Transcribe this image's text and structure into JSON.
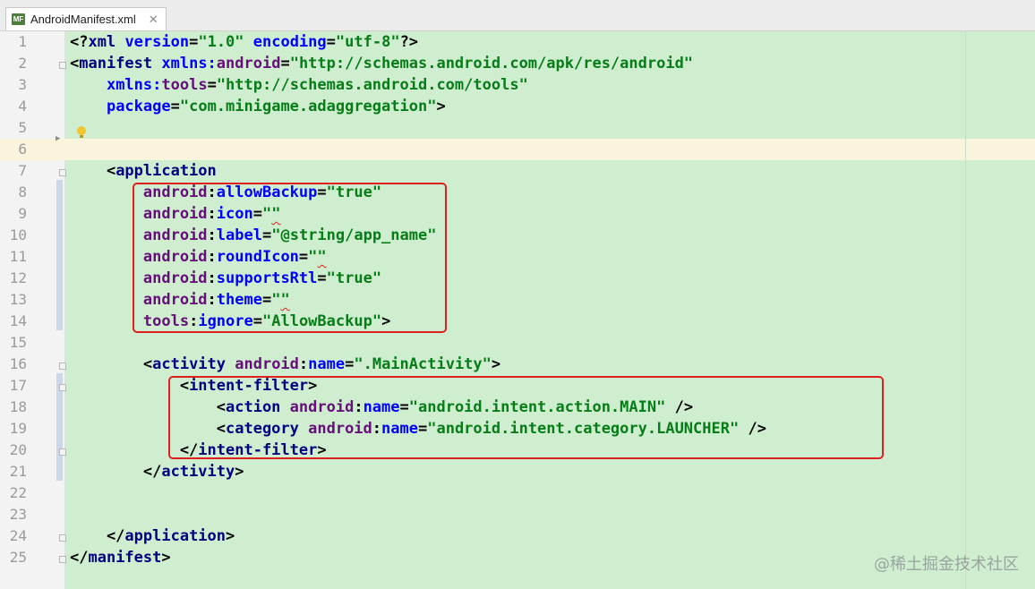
{
  "tab": {
    "file_name": "AndroidManifest.xml",
    "icon_label": "MF",
    "close_glyph": "✕"
  },
  "code": {
    "line_numbers": [
      "1",
      "2",
      "3",
      "4",
      "5",
      "6",
      "7",
      "8",
      "9",
      "10",
      "11",
      "12",
      "13",
      "14",
      "15",
      "16",
      "17",
      "18",
      "19",
      "20",
      "21",
      "22",
      "23",
      "24",
      "25"
    ],
    "current_line": 6,
    "lines": [
      {
        "n": 1,
        "parts": [
          [
            "p",
            "<?"
          ],
          [
            "tag",
            "xml "
          ],
          [
            "attr",
            "version"
          ],
          [
            "p",
            "="
          ],
          [
            "val",
            "\"1.0\" "
          ],
          [
            "attr",
            "encoding"
          ],
          [
            "p",
            "="
          ],
          [
            "val",
            "\"utf-8\""
          ],
          [
            "p",
            "?>"
          ]
        ]
      },
      {
        "n": 2,
        "parts": [
          [
            "p",
            "<"
          ],
          [
            "tag",
            "manifest "
          ],
          [
            "attr",
            "xmlns:"
          ],
          [
            "ns",
            "android"
          ],
          [
            "p",
            "="
          ],
          [
            "val",
            "\"http://schemas.android.com/apk/res/android\""
          ]
        ]
      },
      {
        "n": 3,
        "parts": [
          [
            "p",
            "    "
          ],
          [
            "attr",
            "xmlns:"
          ],
          [
            "ns",
            "tools"
          ],
          [
            "p",
            "="
          ],
          [
            "val",
            "\"http://schemas.android.com/tools\""
          ]
        ]
      },
      {
        "n": 4,
        "parts": [
          [
            "p",
            "    "
          ],
          [
            "attr",
            "package"
          ],
          [
            "p",
            "="
          ],
          [
            "val",
            "\"com.minigame.adaggregation\""
          ],
          [
            "p",
            ">"
          ]
        ]
      },
      {
        "n": 5,
        "parts": []
      },
      {
        "n": 6,
        "parts": []
      },
      {
        "n": 7,
        "parts": [
          [
            "p",
            "    <"
          ],
          [
            "tag",
            "application"
          ]
        ]
      },
      {
        "n": 8,
        "parts": [
          [
            "p",
            "        "
          ],
          [
            "ns",
            "android"
          ],
          [
            "p",
            ":"
          ],
          [
            "attr",
            "allowBackup"
          ],
          [
            "p",
            "="
          ],
          [
            "val",
            "\"true\""
          ]
        ]
      },
      {
        "n": 9,
        "parts": [
          [
            "p",
            "        "
          ],
          [
            "ns",
            "android"
          ],
          [
            "p",
            ":"
          ],
          [
            "attr",
            "icon"
          ],
          [
            "p",
            "="
          ],
          [
            "val",
            "\""
          ],
          [
            "sq",
            "\""
          ]
        ]
      },
      {
        "n": 10,
        "parts": [
          [
            "p",
            "        "
          ],
          [
            "ns",
            "android"
          ],
          [
            "p",
            ":"
          ],
          [
            "attr",
            "label"
          ],
          [
            "p",
            "="
          ],
          [
            "val",
            "\"@string/app_name\""
          ]
        ]
      },
      {
        "n": 11,
        "parts": [
          [
            "p",
            "        "
          ],
          [
            "ns",
            "android"
          ],
          [
            "p",
            ":"
          ],
          [
            "attr",
            "roundIcon"
          ],
          [
            "p",
            "="
          ],
          [
            "val",
            "\""
          ],
          [
            "sq",
            "\""
          ]
        ]
      },
      {
        "n": 12,
        "parts": [
          [
            "p",
            "        "
          ],
          [
            "ns",
            "android"
          ],
          [
            "p",
            ":"
          ],
          [
            "attr",
            "supportsRtl"
          ],
          [
            "p",
            "="
          ],
          [
            "val",
            "\"true\""
          ]
        ]
      },
      {
        "n": 13,
        "parts": [
          [
            "p",
            "        "
          ],
          [
            "ns",
            "android"
          ],
          [
            "p",
            ":"
          ],
          [
            "attr",
            "theme"
          ],
          [
            "p",
            "="
          ],
          [
            "val",
            "\""
          ],
          [
            "sq",
            "\""
          ]
        ]
      },
      {
        "n": 14,
        "parts": [
          [
            "p",
            "        "
          ],
          [
            "ns",
            "tools"
          ],
          [
            "p",
            ":"
          ],
          [
            "attr",
            "ignore"
          ],
          [
            "p",
            "="
          ],
          [
            "val",
            "\"AllowBackup\""
          ],
          [
            "p",
            ">"
          ]
        ]
      },
      {
        "n": 15,
        "parts": []
      },
      {
        "n": 16,
        "parts": [
          [
            "p",
            "        <"
          ],
          [
            "tag",
            "activity "
          ],
          [
            "ns",
            "android"
          ],
          [
            "p",
            ":"
          ],
          [
            "attr",
            "name"
          ],
          [
            "p",
            "="
          ],
          [
            "val",
            "\".MainActivity\""
          ],
          [
            "p",
            ">"
          ]
        ]
      },
      {
        "n": 17,
        "parts": [
          [
            "p",
            "            <"
          ],
          [
            "tag",
            "intent-filter"
          ],
          [
            "p",
            ">"
          ]
        ]
      },
      {
        "n": 18,
        "parts": [
          [
            "p",
            "                <"
          ],
          [
            "tag",
            "action "
          ],
          [
            "ns",
            "android"
          ],
          [
            "p",
            ":"
          ],
          [
            "attr",
            "name"
          ],
          [
            "p",
            "="
          ],
          [
            "val",
            "\"android.intent.action.MAIN\""
          ],
          [
            "p",
            " />"
          ]
        ]
      },
      {
        "n": 19,
        "parts": [
          [
            "p",
            "                <"
          ],
          [
            "tag",
            "category "
          ],
          [
            "ns",
            "android"
          ],
          [
            "p",
            ":"
          ],
          [
            "attr",
            "name"
          ],
          [
            "p",
            "="
          ],
          [
            "val",
            "\"android.intent.category.LAUNCHER\""
          ],
          [
            "p",
            " />"
          ]
        ]
      },
      {
        "n": 20,
        "parts": [
          [
            "p",
            "            </"
          ],
          [
            "tag",
            "intent-filter"
          ],
          [
            "p",
            ">"
          ]
        ]
      },
      {
        "n": 21,
        "parts": [
          [
            "p",
            "        </"
          ],
          [
            "tag",
            "activity"
          ],
          [
            "p",
            ">"
          ]
        ]
      },
      {
        "n": 22,
        "parts": []
      },
      {
        "n": 23,
        "parts": []
      },
      {
        "n": 24,
        "parts": [
          [
            "p",
            "    </"
          ],
          [
            "tag",
            "application"
          ],
          [
            "p",
            ">"
          ]
        ]
      },
      {
        "n": 25,
        "parts": [
          [
            "p",
            "</"
          ],
          [
            "tag",
            "manifest"
          ],
          [
            "p",
            ">"
          ]
        ]
      }
    ]
  },
  "colors": {
    "code_background": "#cfeed0",
    "current_line": "#fbf4dc",
    "highlight_box": "#e02020",
    "tag": "#000080",
    "attribute": "#0000ff",
    "namespace": "#660e7a",
    "value": "#067d17"
  },
  "icons": {
    "intention_bulb": "lightbulb-icon",
    "fold": "fold-marker-icon"
  },
  "watermark": "@稀土掘金技术社区"
}
